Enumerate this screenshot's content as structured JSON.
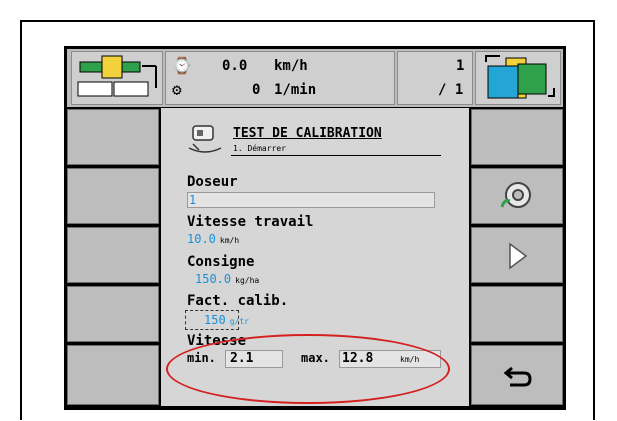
{
  "header": {
    "speed_value": "0.0",
    "speed_unit": "km/h",
    "rpm_value": "0",
    "rpm_unit": "1/min",
    "counter_top": "1",
    "counter_bottom": "/ 1"
  },
  "dialog": {
    "title": "TEST DE CALIBRATION",
    "subtitle": "1. Démarrer",
    "fields": [
      {
        "label": "Doseur",
        "value": "1",
        "unit": ""
      },
      {
        "label": "Vitesse travail",
        "value": "10.0",
        "unit": "km/h"
      },
      {
        "label": "Consigne",
        "value": "150.0",
        "unit": "kg/ha"
      },
      {
        "label": "Fact. calib.",
        "value": "150",
        "unit": "g/tr"
      }
    ],
    "speed_section": {
      "label": "Vitesse",
      "min_label": "min.",
      "min_value": "2.1",
      "max_label": "max.",
      "max_value": "12.8",
      "unit": "km/h"
    }
  },
  "icons": {
    "calibration": "calibration-icon",
    "settings_wheel": "gear-wheel-icon",
    "next": "play-next-icon",
    "back": "return-icon"
  },
  "colors": {
    "value_blue": "#1a8fd8",
    "highlight_red": "#d42020",
    "panel_grey": "#d6d6d6"
  }
}
